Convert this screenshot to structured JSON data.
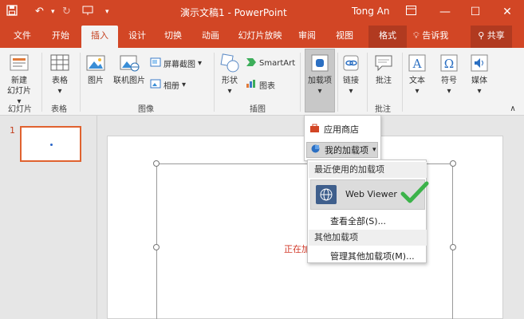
{
  "titlebar": {
    "title": "演示文稿1 - PowerPoint",
    "user": "Tong An",
    "color": "#d24625"
  },
  "tabs": [
    "文件",
    "开始",
    "插入",
    "设计",
    "切换",
    "动画",
    "幻灯片放映",
    "审阅",
    "视图",
    "格式",
    "告诉我",
    "共享"
  ],
  "active_tab": "插入",
  "ribbon": {
    "new_slide": [
      "新建",
      "幻灯片"
    ],
    "table": "表格",
    "picture": "图片",
    "online_picture": "联机图片",
    "screenshot": "屏幕截图",
    "album": "相册",
    "shapes": "形状",
    "smartart": "SmartArt",
    "chart": "图表",
    "addins": "加载项",
    "link": "链接",
    "comment": "批注",
    "text": "文本",
    "symbol": "符号",
    "media": "媒体",
    "groups": {
      "slides": "幻灯片",
      "tables": "表格",
      "images": "图像",
      "illustrations": "插图",
      "comments": "批注"
    }
  },
  "thumbnail": {
    "number": "1"
  },
  "slide": {
    "loading_text": "正在加"
  },
  "addins_menu": {
    "store": "应用商店",
    "my_addins": "我的加载项",
    "recent_header": "最近使用的加载项",
    "web_viewer": "Web Viewer",
    "see_all": "查看全部(S)...",
    "other_header": "其他加载项",
    "manage": "管理其他加载项(M)..."
  },
  "colors": {
    "accent": "#d24625",
    "check": "#3cb34a"
  }
}
